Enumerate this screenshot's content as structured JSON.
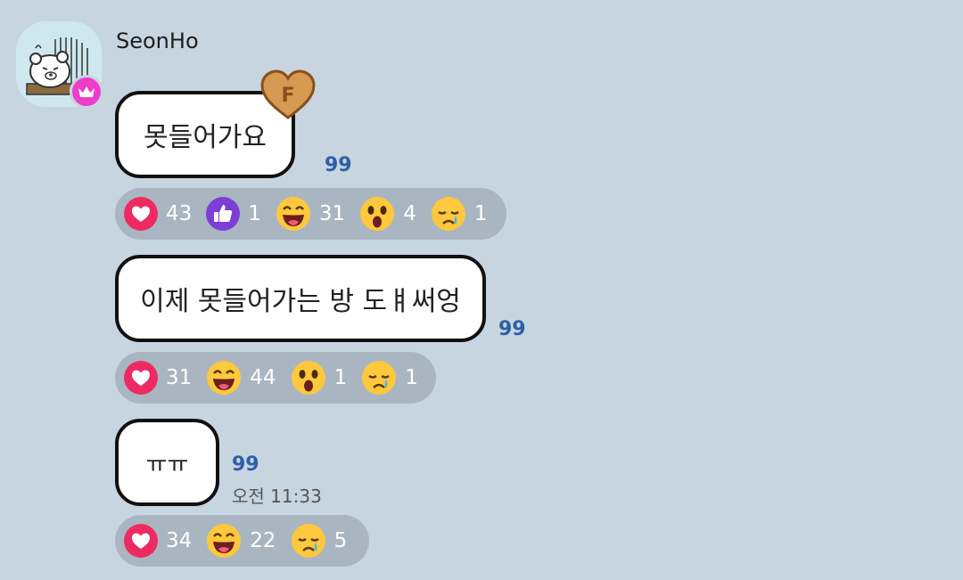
{
  "sender": {
    "name": "SeonHo"
  },
  "colors": {
    "background": "#c7d5e1",
    "reaction_bar": "#a9b6c1",
    "crown_badge": "#ee3ec9",
    "heart": "#ee2a63",
    "like": "#7b3fd6",
    "unread": "#2d5fa7",
    "heart_badge": "#d79a52"
  },
  "heart_badge_label": "F",
  "messages": [
    {
      "text": "못들어가요",
      "unread": "99",
      "reactions": [
        {
          "icon": "heart-icon",
          "count": "43"
        },
        {
          "icon": "thumbs-up-icon",
          "count": "1"
        },
        {
          "icon": "laughing-face-icon",
          "count": "31"
        },
        {
          "icon": "surprised-face-icon",
          "count": "4"
        },
        {
          "icon": "crying-face-icon",
          "count": "1"
        }
      ]
    },
    {
      "text": "이제 못들어가는 방 도ㅒ써엉",
      "unread": "99",
      "reactions": [
        {
          "icon": "heart-icon",
          "count": "31"
        },
        {
          "icon": "laughing-face-icon",
          "count": "44"
        },
        {
          "icon": "surprised-face-icon",
          "count": "1"
        },
        {
          "icon": "crying-face-icon",
          "count": "1"
        }
      ]
    },
    {
      "text": "ㅠㅠ",
      "unread": "99",
      "time": "오전 11:33",
      "reactions": [
        {
          "icon": "heart-icon",
          "count": "34"
        },
        {
          "icon": "laughing-face-icon",
          "count": "22"
        },
        {
          "icon": "crying-face-icon",
          "count": "5"
        }
      ]
    }
  ]
}
